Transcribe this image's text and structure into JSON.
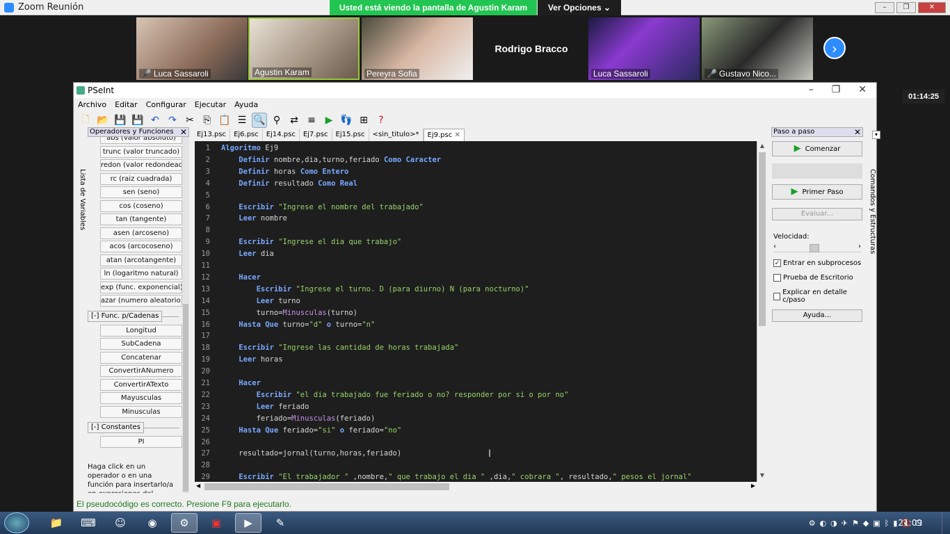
{
  "zoom": {
    "app_title": "Zoom Reunión",
    "share_banner": "Usted está viendo la pantalla de Agustin Karam",
    "view_options": "Ver Opciones",
    "participants": [
      {
        "name": "Luca Sassaroli",
        "muted": true
      },
      {
        "name": "Agustin Karam",
        "muted": false
      },
      {
        "name": "Pereyra Sofia",
        "muted": false
      },
      {
        "name": "Rodrigo Bracco",
        "muted": false
      },
      {
        "name": "Luca Sassaroli",
        "muted": false
      },
      {
        "name": "Gustavo Nico...",
        "muted": true
      }
    ],
    "timer": "01:14:25"
  },
  "pseint": {
    "title": "PSeInt",
    "menu": [
      "Archivo",
      "Editar",
      "Configurar",
      "Ejecutar",
      "Ayuda"
    ],
    "left_vertical_tab": "Lista de Variables",
    "ops_header": "Operadores y Funciones",
    "ops_buttons": [
      "abs (valor absoluto)",
      "trunc (valor truncado)",
      "redon (valor redondeado)",
      "rc (raiz cuadrada)",
      "sen (seno)",
      "cos (coseno)",
      "tan (tangente)",
      "asen (arcoseno)",
      "acos (arcocoseno)",
      "atan (arcotangente)",
      "ln (logaritmo natural)",
      "exp (func. exponencial)",
      "azar (numero aleatorio)"
    ],
    "group_cadenas": "[-]  Func. p/Cadenas",
    "cadenas_buttons": [
      "Longitud",
      "SubCadena",
      "Concatenar",
      "ConvertirANumero",
      "ConvertirATexto",
      "Mayusculas",
      "Minusculas"
    ],
    "group_constantes": "[-]  Constantes",
    "constantes_buttons": [
      "PI"
    ],
    "help_text": "Haga click en un operador o en una función para insertarlo/a en expresiones del pseudocódigo.",
    "tabs": [
      "Ej13.psc",
      "Ej6.psc",
      "Ej14.psc",
      "Ej7.psc",
      "Ej15.psc",
      "<sin_titulo>*",
      "Ej9.psc"
    ],
    "active_tab_close": "✕",
    "code_lines": [
      [
        [
          "kw",
          "Algoritmo"
        ],
        [
          "t",
          " Ej9"
        ]
      ],
      [
        [
          "t",
          "    "
        ],
        [
          "kw",
          "Definir"
        ],
        [
          "t",
          " nombre,dia,turno,feriado "
        ],
        [
          "kw",
          "Como Caracter"
        ]
      ],
      [
        [
          "t",
          "    "
        ],
        [
          "kw",
          "Definir"
        ],
        [
          "t",
          " horas "
        ],
        [
          "kw",
          "Como Entero"
        ]
      ],
      [
        [
          "t",
          "    "
        ],
        [
          "kw",
          "Definir"
        ],
        [
          "t",
          " resultado "
        ],
        [
          "kw",
          "Como Real"
        ]
      ],
      [],
      [
        [
          "t",
          "    "
        ],
        [
          "kw",
          "Escribir"
        ],
        [
          "t",
          " "
        ],
        [
          "str",
          "\"Ingrese el nombre del trabajado\""
        ]
      ],
      [
        [
          "t",
          "    "
        ],
        [
          "kw",
          "Leer"
        ],
        [
          "t",
          " nombre"
        ]
      ],
      [],
      [
        [
          "t",
          "    "
        ],
        [
          "kw",
          "Escribir"
        ],
        [
          "t",
          " "
        ],
        [
          "str",
          "\"Ingrese el dia que trabajo\""
        ]
      ],
      [
        [
          "t",
          "    "
        ],
        [
          "kw",
          "Leer"
        ],
        [
          "t",
          " dia"
        ]
      ],
      [],
      [
        [
          "t",
          "    "
        ],
        [
          "kw",
          "Hacer"
        ]
      ],
      [
        [
          "t",
          "        "
        ],
        [
          "kw",
          "Escribir"
        ],
        [
          "t",
          " "
        ],
        [
          "str",
          "\"Ingrese el turno. D (para diurno) N (para nocturno)\""
        ]
      ],
      [
        [
          "t",
          "        "
        ],
        [
          "kw",
          "Leer"
        ],
        [
          "t",
          " turno"
        ]
      ],
      [
        [
          "t",
          "        turno="
        ],
        [
          "fn",
          "Minusculas"
        ],
        [
          "t",
          "(turno)"
        ]
      ],
      [
        [
          "t",
          "    "
        ],
        [
          "kw",
          "Hasta Que"
        ],
        [
          "t",
          " turno="
        ],
        [
          "str",
          "\"d\""
        ],
        [
          "t",
          " "
        ],
        [
          "kw",
          "o"
        ],
        [
          "t",
          " turno="
        ],
        [
          "str",
          "\"n\""
        ]
      ],
      [],
      [
        [
          "t",
          "    "
        ],
        [
          "kw",
          "Escribir"
        ],
        [
          "t",
          " "
        ],
        [
          "str",
          "\"Ingrese las cantidad de horas trabajada\""
        ]
      ],
      [
        [
          "t",
          "    "
        ],
        [
          "kw",
          "Leer"
        ],
        [
          "t",
          " horas"
        ]
      ],
      [],
      [
        [
          "t",
          "    "
        ],
        [
          "kw",
          "Hacer"
        ]
      ],
      [
        [
          "t",
          "        "
        ],
        [
          "kw",
          "Escribir"
        ],
        [
          "t",
          " "
        ],
        [
          "str",
          "\"el dia trabajado fue feriado o no? responder por si o por no\""
        ]
      ],
      [
        [
          "t",
          "        "
        ],
        [
          "kw",
          "Leer"
        ],
        [
          "t",
          " feriado"
        ]
      ],
      [
        [
          "t",
          "        feriado="
        ],
        [
          "fn",
          "Minusculas"
        ],
        [
          "t",
          "(feriado)"
        ]
      ],
      [
        [
          "t",
          "    "
        ],
        [
          "kw",
          "Hasta Que"
        ],
        [
          "t",
          " feriado="
        ],
        [
          "str",
          "\"si\""
        ],
        [
          "t",
          " "
        ],
        [
          "kw",
          "o"
        ],
        [
          "t",
          " feriado="
        ],
        [
          "str",
          "\"no\""
        ]
      ],
      [],
      [
        [
          "t",
          "    resultado=jornal(turno,horas,feriado)"
        ]
      ],
      [],
      [
        [
          "t",
          "    "
        ],
        [
          "kw",
          "Escribir"
        ],
        [
          "t",
          " "
        ],
        [
          "str",
          "\"El trabajador \""
        ],
        [
          "t",
          " ,nombre,"
        ],
        [
          "str",
          "\" que trabajo el dia \""
        ],
        [
          "t",
          " ,dia,"
        ],
        [
          "str",
          "\" cobrara \""
        ],
        [
          "t",
          ", resultado,"
        ],
        [
          "str",
          "\" pesos el jornal\""
        ]
      ]
    ],
    "right_panel": {
      "header": "Paso a paso",
      "start_button": "Comenzar",
      "first_step_button": "Primer Paso",
      "evaluate_button": "Evaluar...",
      "speed_label": "Velocidad:",
      "checkboxes": [
        {
          "label": "Entrar en subprocesos",
          "checked": true
        },
        {
          "label": "Prueba de Escritorio",
          "checked": false
        },
        {
          "label": "Explicar en detalle c/paso",
          "checked": false
        }
      ],
      "help_button": "Ayuda..."
    },
    "right_vertical_tab": "Comandos y Estructuras",
    "status": "El pseudocódigo es correcto. Presione F9 para ejecutarlo."
  },
  "taskbar": {
    "clock": "21:09"
  }
}
